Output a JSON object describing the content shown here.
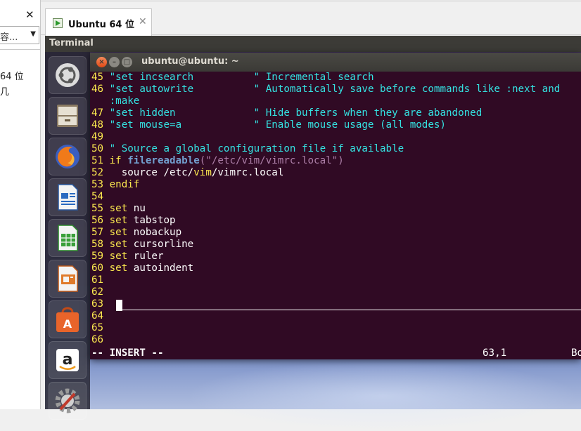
{
  "left_pane": {
    "close_glyph": "✕",
    "combo_text": "容...",
    "items": [
      "64 位",
      "几"
    ]
  },
  "vmware": {
    "tab_label": "Ubuntu 64 位",
    "tab_close": "✕"
  },
  "ubuntu": {
    "topbar_title": "Terminal",
    "launcher": [
      {
        "name": "ubuntu-dash-icon"
      },
      {
        "name": "files-icon"
      },
      {
        "name": "firefox-icon"
      },
      {
        "name": "libreoffice-writer-icon"
      },
      {
        "name": "libreoffice-calc-icon"
      },
      {
        "name": "libreoffice-impress-icon"
      },
      {
        "name": "software-center-icon"
      },
      {
        "name": "amazon-icon"
      },
      {
        "name": "system-settings-icon"
      }
    ]
  },
  "terminal": {
    "title": "ubuntu@ubuntu: ~",
    "close_glyph": "×",
    "min_glyph": "–",
    "max_glyph": "□",
    "lines": [
      {
        "n": "45",
        "a": "\"set incsearch",
        "b": "          \" Incremental search"
      },
      {
        "n": "46",
        "a": "\"set autowrite",
        "b": "          \" Automatically save before commands like :next and"
      },
      {
        "n": "",
        "a": ":make",
        "b": ""
      },
      {
        "n": "47",
        "a": "\"set hidden",
        "b": "             \" Hide buffers when they are abandoned"
      },
      {
        "n": "48",
        "a": "\"set mouse=a",
        "b": "            \" Enable mouse usage (all modes)"
      },
      {
        "n": "49",
        "a": "",
        "b": ""
      },
      {
        "n": "50",
        "a": "\" Source a global configuration file if available",
        "b": ""
      },
      {
        "n": "51",
        "a": "if ",
        "fn": "filereadable",
        "s": "(\"/etc/vim/vimrc.local\")"
      },
      {
        "n": "52",
        "a": "  source /etc/",
        "v": "vim",
        "c": "/vimrc.local"
      },
      {
        "n": "53",
        "a": "endif",
        "b": ""
      },
      {
        "n": "54",
        "a": "",
        "b": ""
      },
      {
        "n": "55",
        "k": "set",
        "r": " nu"
      },
      {
        "n": "56",
        "k": "set",
        "r": " tabstop"
      },
      {
        "n": "57",
        "k": "set",
        "r": " nobackup"
      },
      {
        "n": "58",
        "k": "set",
        "r": " cursorline"
      },
      {
        "n": "59",
        "k": "set",
        "r": " ruler"
      },
      {
        "n": "60",
        "k": "set",
        "r": " autoindent"
      },
      {
        "n": "61"
      },
      {
        "n": "62"
      },
      {
        "n": "63"
      },
      {
        "n": "64"
      },
      {
        "n": "65"
      },
      {
        "n": "66"
      }
    ],
    "status": {
      "mode": "-- INSERT --",
      "position": "63,1",
      "percent": "Bo"
    }
  }
}
